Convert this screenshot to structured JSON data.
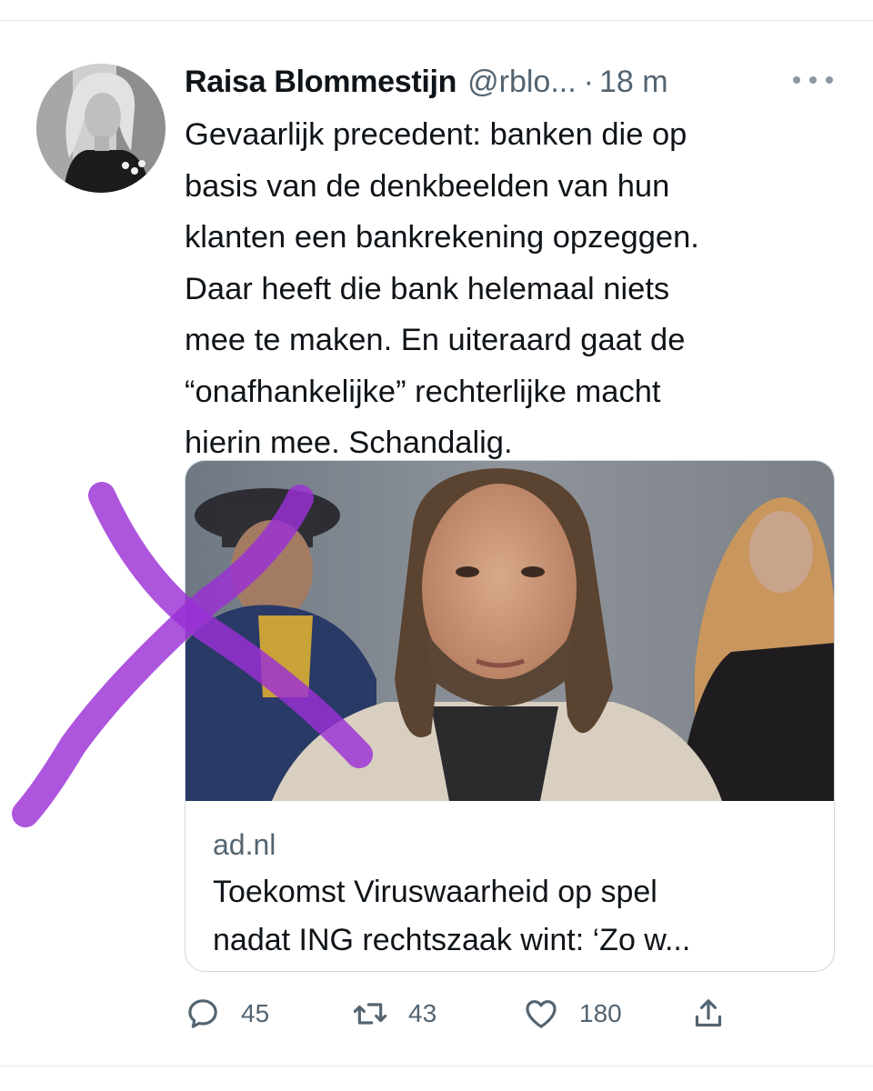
{
  "tweet": {
    "author_name": "Raisa Blommestijn",
    "handle": "@rblo...",
    "separator": "·",
    "time": "18 m",
    "lines": [
      "Gevaarlijk precedent: banken die op",
      "basis van de denkbeelden van hun",
      "klanten een bankrekening opzeggen.",
      "Daar heeft die bank helemaal niets",
      "mee te maken. En uiteraard gaat de",
      "“onafhankelijke” rechterlijke macht",
      "hierin mee. Schandalig."
    ]
  },
  "card": {
    "domain": "ad.nl",
    "title_lines": [
      "Toekomst Viruswaarheid op spel",
      "nadat ING rechtszaak wint: ‘Zo w..."
    ]
  },
  "actions": {
    "replies": "45",
    "retweets": "43",
    "likes": "180"
  },
  "icons": {
    "more": "more-icon",
    "reply": "reply-icon",
    "retweet": "retweet-icon",
    "like": "heart-icon",
    "share": "share-icon"
  },
  "colors": {
    "text": "#0f1419",
    "secondary": "#536471",
    "border": "#cfd9de",
    "annotation": "#9b2fd6"
  }
}
